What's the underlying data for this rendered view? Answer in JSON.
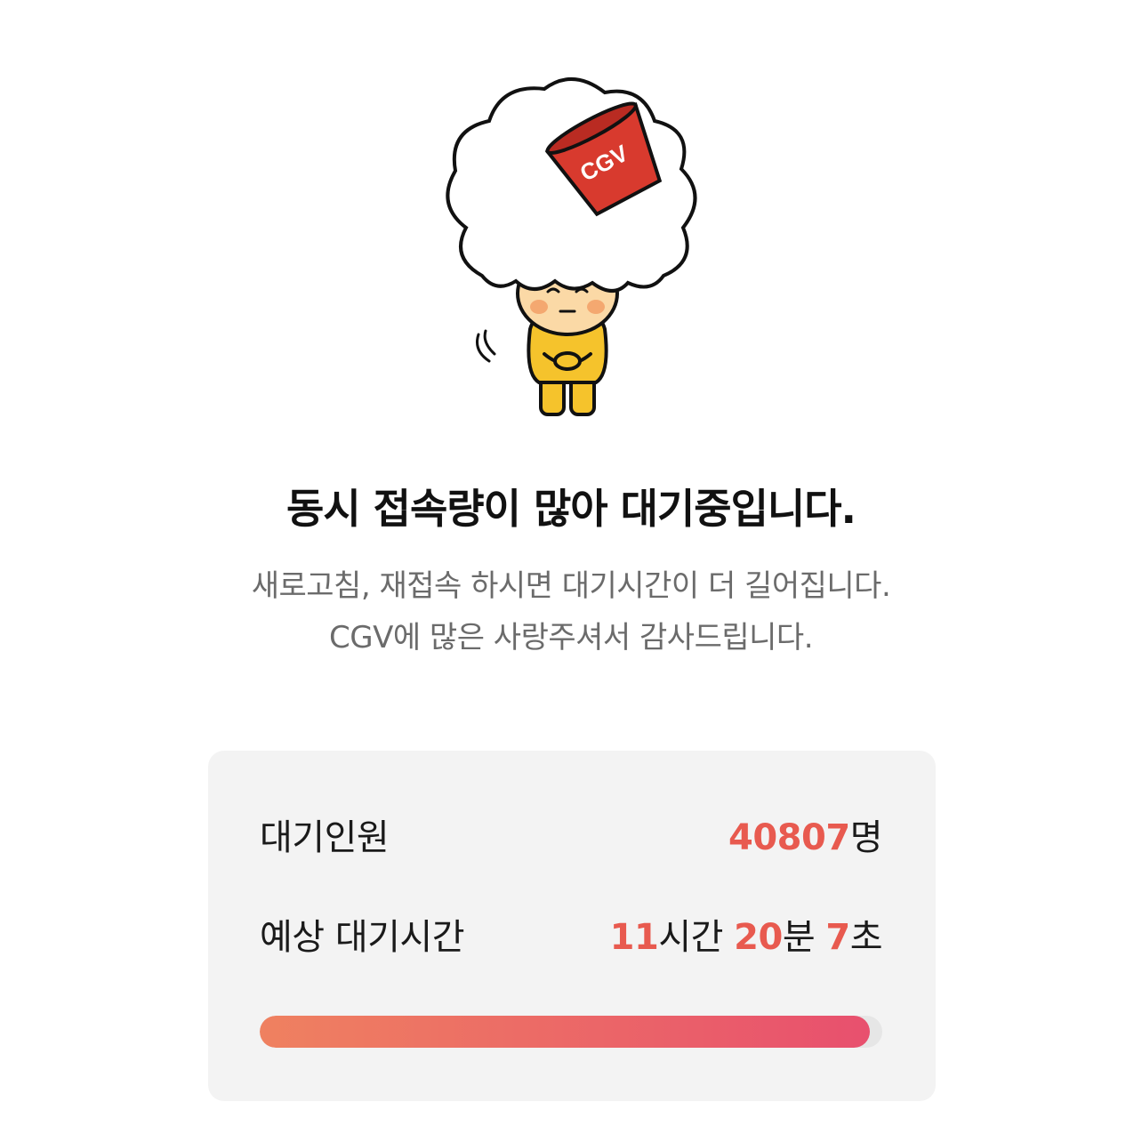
{
  "mascot": {
    "cup_label": "CGV"
  },
  "headline": "동시 접속량이 많아 대기중입니다.",
  "message": {
    "line1": "새로고침, 재접속 하시면 대기시간이 더 길어집니다.",
    "line2": "CGV에 많은 사랑주셔서 감사드립니다."
  },
  "queue": {
    "count_label": "대기인원",
    "count_value": "40807",
    "count_unit": "명",
    "eta_label": "예상 대기시간",
    "eta_hours": "11",
    "eta_hours_unit": "시간",
    "eta_minutes": "20",
    "eta_minutes_unit": "분",
    "eta_seconds": "7",
    "eta_seconds_unit": "초",
    "progress_percent": 98
  },
  "colors": {
    "accent": "#e85a4f",
    "progress_start": "#ef8160",
    "progress_end": "#e8506e",
    "card_bg": "#f3f3f3"
  }
}
